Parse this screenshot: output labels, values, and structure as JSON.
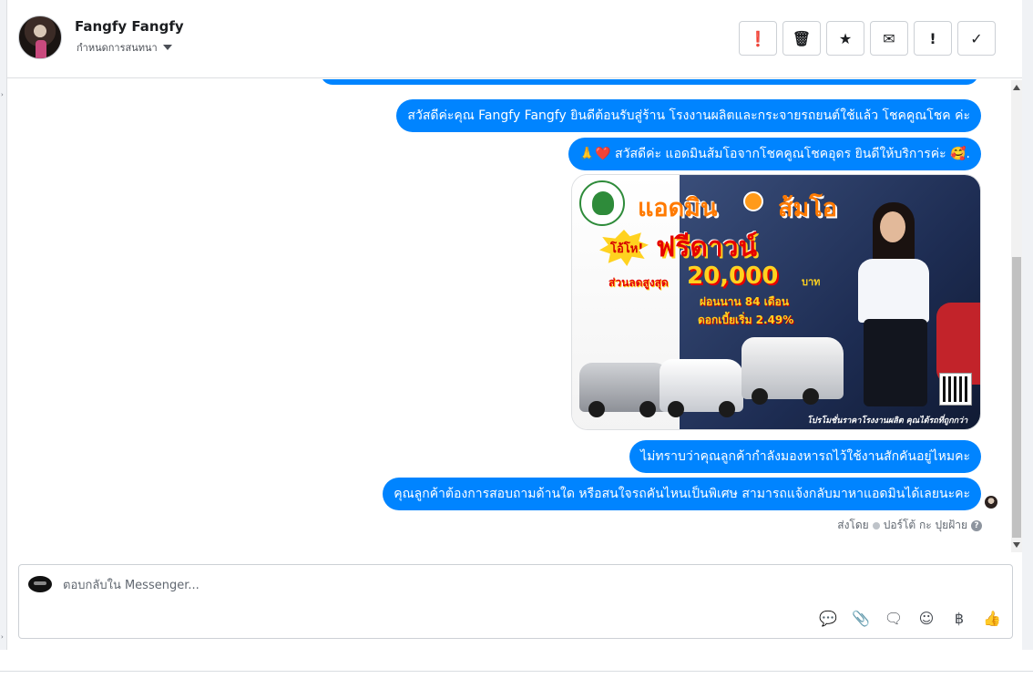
{
  "conversation": {
    "contact_name": "Fangfy Fangfy",
    "assign_label": "กำหนดการสนทนา"
  },
  "toolbar": {
    "buttons": [
      {
        "icon": "alert-circle-icon",
        "glyph": "❗"
      },
      {
        "icon": "trash-icon",
        "glyph": "🗑"
      },
      {
        "icon": "star-icon",
        "glyph": "★"
      },
      {
        "icon": "envelope-icon",
        "glyph": "✉"
      },
      {
        "icon": "exclamation-icon",
        "glyph": "!"
      },
      {
        "icon": "checkmark-icon",
        "glyph": "✓"
      }
    ]
  },
  "messages": [
    {
      "text": "สวัสดีค่ะคุณ Fangfy Fangfy ยินดีต้อนรับสู่ร้าน โรงงานผลิตและกระจายรถยนต์ใช้แล้ว โชคคูณโชค ค่ะ"
    },
    {
      "text": "🙏❤️ สวัสดีค่ะ แอดมินส้มโอจากโชคคูณโชคอุดร ยินดีให้บริการค่ะ 🥰."
    },
    {
      "text": "ไม่ทราบว่าคุณลูกค้ากำลังมองหารถไว้ใช้งานสักคันอยู่ไหมคะ"
    },
    {
      "text": "คุณลูกค้าต้องการสอบถามด้านใด หรือสนใจรถคันไหนเป็นพิเศษ สามารถแจ้งกลับมาหาแอดมินได้เลยนะคะ"
    }
  ],
  "promo_image": {
    "title_part1": "แอดมิน",
    "title_part2": "ส้มโอ",
    "badge": "โอ้โห!",
    "headline": "ฟรีดาวน์",
    "discount_label": "ส่วนลดสูงสุด",
    "discount_amount": "20,000",
    "currency": "บาท",
    "installment": "ผ่อนนาน 84 เดือน",
    "interest": "ดอกเบี้ยเริ่ม 2.49%",
    "footer": "โปรโมชั่นราคาโรงงานผลิต คุณได้รถที่ถูกกว่า"
  },
  "sent_by": {
    "label": "ส่งโดย",
    "name": "ปอร์โต้ กะ ปุยฝ้าย"
  },
  "composer": {
    "placeholder": "ตอบกลับใน Messenger...",
    "icons": [
      {
        "icon": "saved-reply-icon",
        "glyph": "💬"
      },
      {
        "icon": "paperclip-icon",
        "glyph": "📎"
      },
      {
        "icon": "chat-bubble-icon",
        "glyph": "🗨"
      },
      {
        "icon": "emoji-icon",
        "glyph": "☺"
      },
      {
        "icon": "baht-icon",
        "glyph": "฿"
      },
      {
        "icon": "thumbs-up-icon",
        "glyph": "👍"
      }
    ]
  },
  "colors": {
    "accent": "#0084ff",
    "promo_orange": "#ff7a00",
    "promo_red": "#e60000",
    "promo_yellow": "#ffd21f"
  }
}
